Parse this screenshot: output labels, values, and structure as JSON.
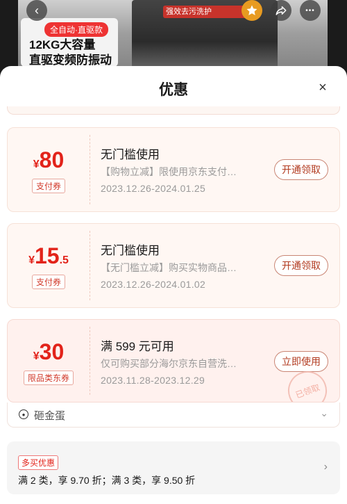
{
  "background": {
    "promo_tag": "全自动·直驱款",
    "promo_line1": "12KG大容量",
    "promo_line2": "直驱变频防振动",
    "banner_text": "强效去污洗护"
  },
  "top_buttons": {
    "back": "‹",
    "share": "↗",
    "more": "•••"
  },
  "sheet": {
    "title": "优惠",
    "close": "×"
  },
  "coupons": [
    {
      "yen": "¥",
      "amount": "80",
      "decimal": "",
      "tag": "支付券",
      "title": "无门槛使用",
      "desc": "【购物立减】限使用京东支付…",
      "date": "2023.12.26-2024.01.25",
      "button": "开通领取"
    },
    {
      "yen": "¥",
      "amount": "15",
      "decimal": ".5",
      "tag": "支付券",
      "title": "无门槛使用",
      "desc": "【无门槛立减】购买实物商品…",
      "date": "2023.12.26-2024.01.02",
      "button": "开通领取"
    },
    {
      "yen": "¥",
      "amount": "30",
      "decimal": "",
      "tag": "限品类东券",
      "title": "满 599 元可用",
      "desc": "仅可购买部分海尔京东自营洗…",
      "date": "2023.11.28-2023.12.29",
      "button": "立即使用",
      "stamp": "已领取"
    }
  ],
  "golden_egg": {
    "label": "砸金蛋",
    "icon": "egg-icon"
  },
  "multi_buy": {
    "tag": "多买优惠",
    "text": "满 2 类，享 9.70 折；满 3 类，享 9.50 折"
  },
  "colors": {
    "accent": "#e2231a",
    "coupon_bg": "#fff7f3",
    "button_border": "#c98574"
  }
}
